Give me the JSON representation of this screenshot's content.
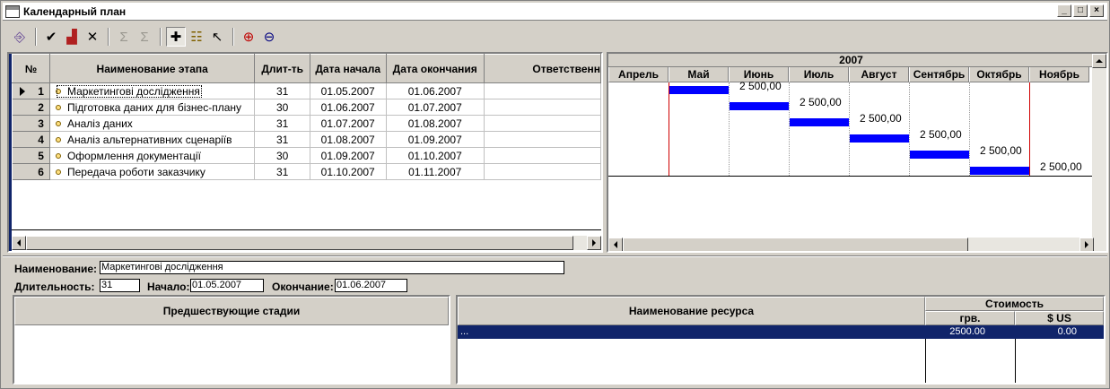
{
  "window": {
    "title": "Календарный план",
    "buttons": {
      "minimize": "_",
      "maximize": "□",
      "close": "×"
    }
  },
  "toolbar": {
    "items": [
      {
        "name": "exit-icon",
        "glyph": "⎆"
      },
      {
        "name": "check-icon",
        "glyph": "✔"
      },
      {
        "name": "chart-icon",
        "glyph": "▟"
      },
      {
        "name": "delete-icon",
        "glyph": "✕"
      },
      {
        "name": "sum-left-icon",
        "glyph": "Σ"
      },
      {
        "name": "sum-right-icon",
        "glyph": "Σ"
      },
      {
        "name": "add-icon",
        "glyph": "✚"
      },
      {
        "name": "hierarchy-icon",
        "glyph": "☷"
      },
      {
        "name": "pointer-icon",
        "glyph": "↖"
      },
      {
        "name": "zoom-in-icon",
        "glyph": "⊕"
      },
      {
        "name": "zoom-out-icon",
        "glyph": "⊖"
      }
    ]
  },
  "stages_table": {
    "columns": [
      "№",
      "Наименование этапа",
      "Длит-ть",
      "Дата начала",
      "Дата окончания",
      "Ответственн"
    ],
    "rows": [
      {
        "num": "1",
        "name": "Маркетингові дослідження",
        "duration": "31",
        "start": "01.05.2007",
        "end": "01.06.2007"
      },
      {
        "num": "2",
        "name": "Підготовка даних для бізнес-плану",
        "duration": "30",
        "start": "01.06.2007",
        "end": "01.07.2007"
      },
      {
        "num": "3",
        "name": "Аналіз даних",
        "duration": "31",
        "start": "01.07.2007",
        "end": "01.08.2007"
      },
      {
        "num": "4",
        "name": "Аналіз альтернативних сценаріїв",
        "duration": "31",
        "start": "01.08.2007",
        "end": "01.09.2007"
      },
      {
        "num": "5",
        "name": "Оформлення документації",
        "duration": "30",
        "start": "01.09.2007",
        "end": "01.10.2007"
      },
      {
        "num": "6",
        "name": "Передача роботи заказчику",
        "duration": "31",
        "start": "01.10.2007",
        "end": "01.11.2007"
      }
    ]
  },
  "gantt": {
    "year": "2007",
    "months": [
      "Апрель",
      "Май",
      "Июнь",
      "Июль",
      "Август",
      "Сентябрь",
      "Октябрь",
      "Ноябрь"
    ],
    "bars": [
      {
        "month_index": 1,
        "label": "2 500,00"
      },
      {
        "month_index": 2,
        "label": "2 500,00"
      },
      {
        "month_index": 3,
        "label": "2 500,00"
      },
      {
        "month_index": 4,
        "label": "2 500,00"
      },
      {
        "month_index": 5,
        "label": "2 500,00"
      },
      {
        "month_index": 6,
        "label": "2 500,00"
      }
    ],
    "bar_color": "#0000ff",
    "marker_color": "#d00000"
  },
  "details": {
    "name_label": "Наименование:",
    "name_value": "Маркетингові дослідження",
    "duration_label": "Длительность:",
    "duration_value": "31",
    "start_label": "Начало:",
    "start_value": "01.05.2007",
    "end_label": "Окончание:",
    "end_value": "01.06.2007"
  },
  "predecessors": {
    "header": "Предшествующие стадии"
  },
  "resources": {
    "header_name": "Наименование ресурса",
    "header_cost": "Стоимость",
    "header_uah": "грв.",
    "header_usd": "$ US",
    "rows": [
      {
        "name": "...",
        "uah": "2500.00",
        "usd": "0.00"
      }
    ]
  },
  "colors": {
    "selection": "#10246a",
    "window_bg": "#d4d0c8"
  }
}
